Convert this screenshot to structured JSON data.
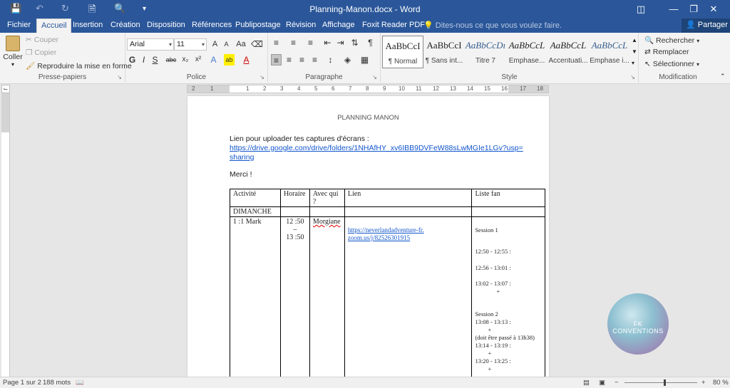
{
  "titlebar": {
    "title": "Planning-Manon.docx - Word",
    "qa_icons": [
      "save-icon",
      "undo-icon",
      "redo-icon",
      "new-document-icon",
      "print-preview-icon",
      "customize-icon"
    ],
    "win_icons": [
      "ribbon-display-icon",
      "minimize-icon",
      "restore-icon",
      "close-icon"
    ]
  },
  "tabs": [
    "Fichier",
    "Accueil",
    "Insertion",
    "Création",
    "Disposition",
    "Références",
    "Publipostage",
    "Révision",
    "Affichage",
    "Foxit Reader PDF"
  ],
  "active_tab": "Accueil",
  "tellme": "Dites-nous ce que vous voulez faire.",
  "share": "Partager",
  "ribbon": {
    "clipboard": {
      "label": "Presse-papiers",
      "paste": "Coller",
      "cut": "Couper",
      "copy": "Copier",
      "format_painter": "Reproduire la mise en forme"
    },
    "font": {
      "label": "Police",
      "font_name": "Arial",
      "font_size": "11",
      "bold": "G",
      "italic": "I",
      "underline": "S",
      "strike": "abc",
      "sub": "x₂",
      "sup": "x²",
      "aa": "Aa",
      "grow": "A",
      "shrink": "A"
    },
    "paragraph": {
      "label": "Paragraphe"
    },
    "styles": {
      "label": "Style",
      "items": [
        {
          "sample": "AaBbCcI",
          "name": "¶ Normal"
        },
        {
          "sample": "AaBbCcI",
          "name": "¶ Sans int..."
        },
        {
          "sample": "AaBbCcDı",
          "name": "Titre 7"
        },
        {
          "sample": "AaBbCcL",
          "name": "Emphase..."
        },
        {
          "sample": "AaBbCcL",
          "name": "Accentuati..."
        },
        {
          "sample": "AaBbCcL",
          "name": "Emphase i..."
        }
      ]
    },
    "editing": {
      "label": "Modification",
      "find": "Rechercher",
      "replace": "Remplacer",
      "select": "Sélectionner"
    }
  },
  "ruler": {
    "numbers": [
      "2",
      "1",
      "1",
      "2",
      "3",
      "4",
      "5",
      "6",
      "7",
      "8",
      "9",
      "10",
      "11",
      "12",
      "13",
      "14",
      "15",
      "16",
      "17",
      "18"
    ]
  },
  "document": {
    "header": "PLANNING MANON",
    "intro": "Lien pour uploader tes captures d'écrans :",
    "link_line1": "https://drive.google.com/drive/folders/1NHAfHY_xv6IBB9DVFeW88sLwMGIe1LGv?usp=",
    "link_line2": "sharing",
    "thanks": "Merci !",
    "table": {
      "headers": [
        "Activité",
        "Horaire",
        "Avec qui ?",
        "Lien",
        "Liste fan"
      ],
      "day": "DIMANCHE",
      "row": {
        "activity": "1 :1 Mark",
        "time_start": "12 :50",
        "time_sep": "–",
        "time_end": "13 :50",
        "with": "Morgiane",
        "link": "https://neverlandadventure-fr.zoom.us/j/82526301915",
        "session1": "Session 1",
        "s1_slot1": "12:50 - 12:55 :",
        "s1_slot2": "12:56 - 13:01 :",
        "s1_slot3": "13:02 - 13:07 :",
        "s1_plus": "+",
        "session2": "Session 2",
        "s2_slot1": "13:08 - 13:13 :",
        "s2_plus1": "+",
        "s2_note": "(doit être passé à 13h38)",
        "s2_slot2": "13:14 - 13:19 :",
        "s2_plus2": "+",
        "s2_slot3": "13:20 - 13:25 :",
        "s2_plus3": "+"
      }
    }
  },
  "watermark": "FK CONVENTIONS",
  "statusbar": {
    "page": "Page 1 sur 2",
    "words": "188 mots",
    "zoom": "80 %",
    "zoom_level_percent": 80
  }
}
